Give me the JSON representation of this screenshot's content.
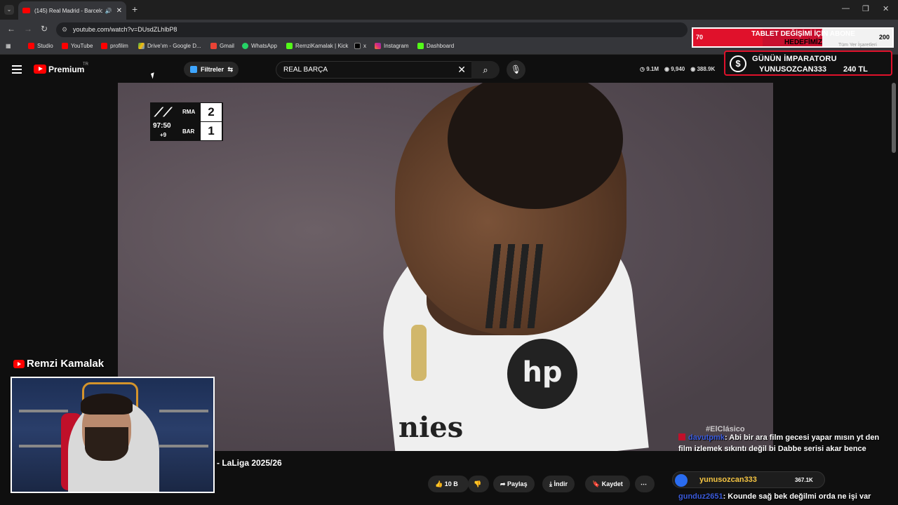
{
  "browser": {
    "tab_title": "(145) Real Madrid - Barcelo",
    "url": "youtube.com/watch?v=DUsdZLhlbP8",
    "bookmarks": [
      "Studio",
      "YouTube",
      "profilim",
      "Drive'ım - Google D...",
      "Gmail",
      "WhatsApp",
      "RemziKamalak | Kick",
      "x",
      "Instagram",
      "Dashboard"
    ],
    "bookmarks_right": "Tüm Yer İşaretleri"
  },
  "overlay": {
    "goal_left": "70",
    "goal_text_line1": "TABLET DEĞİŞİMİ İÇİN ABONE",
    "goal_text_line2": "HEDEFİMİZ",
    "goal_right": "200",
    "goal_progress": 0.35,
    "emperor_title": "GÜNÜN İMPARATORU",
    "emperor_user": "YUNUSOZCAN333",
    "emperor_amount": "240 TL"
  },
  "youtube": {
    "logo": "Premium",
    "logo_suffix": "TR",
    "filters_label": "Filtreler",
    "search_query": "REAL BARÇA",
    "stats": [
      "9.1M",
      "9,940",
      "388.9K"
    ]
  },
  "scoreboard": {
    "home": "RMA",
    "away": "BAR",
    "home_score": "2",
    "away_score": "1",
    "clock": "97:50",
    "added": "+9"
  },
  "video": {
    "sponsor": "nies",
    "shirt_logo": "hp",
    "title_fragment": "- LaLiga 2025/26",
    "hashtag": "#ElClásico"
  },
  "streamer": {
    "name": "Remzi Kamalak"
  },
  "actions": {
    "likes": "10 B",
    "share": "Paylaş",
    "download": "İndir",
    "save": "Kaydet"
  },
  "chat": {
    "msg1_user": "davutpmk",
    "msg1_text": ": Abi bir ara film gecesi yapar mısın yt den film izlemek sıkıntı değil bi Dabbe serisi akar bence",
    "pill_user": "yunusozcan333",
    "pill_count": "367.1K",
    "msg2_user": "gunduz2651",
    "msg2_text": ": Kounde sağ bek değilmi orda ne işi var"
  },
  "colors": {
    "brand": "#ff0000",
    "alert_red": "#c8102e",
    "chat_user": "#3b5bdb"
  }
}
